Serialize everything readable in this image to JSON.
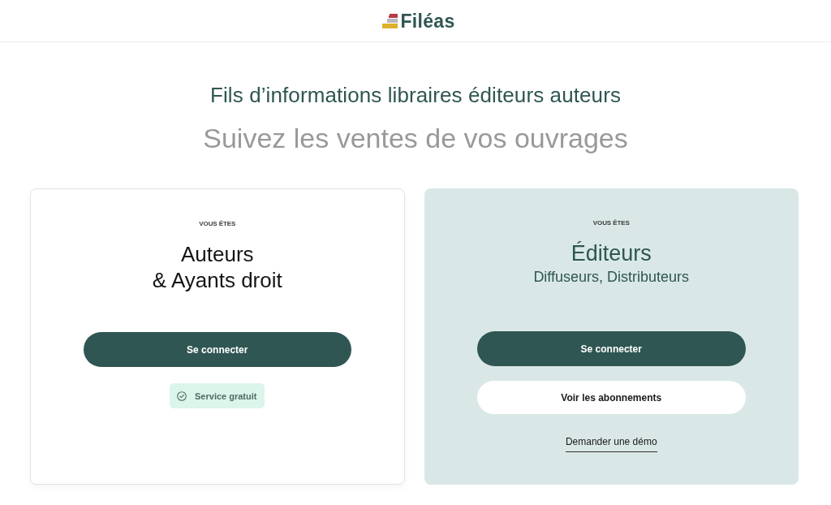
{
  "header": {
    "logo": "Filéas"
  },
  "headline": "Fils d’informations libraires éditeurs auteurs",
  "subheadline": "Suivez les ventes de vos ouvrages",
  "cards": [
    {
      "kind": "plain",
      "eyebrow": "VOUS ÊTES",
      "title_lines": [
        "Auteurs",
        "& Ayants droit"
      ],
      "buttons": [
        {
          "kind": "primary",
          "label": "Se connecter"
        }
      ],
      "badge": "Service gratuit"
    },
    {
      "kind": "tinted",
      "eyebrow": "VOUS ÊTES",
      "title_lines": [
        "Éditeurs"
      ],
      "subtitle": "Diffuseurs, Distributeurs",
      "buttons": [
        {
          "kind": "primary",
          "label": "Se connecter"
        },
        {
          "kind": "secondary",
          "label": "Voir les abonnements"
        }
      ],
      "link": "Demander une démo"
    }
  ]
}
